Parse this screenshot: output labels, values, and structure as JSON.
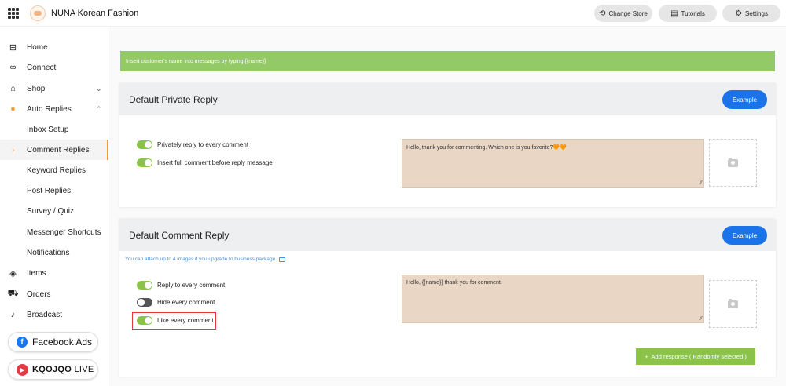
{
  "header": {
    "store_name": "NUNA Korean Fashion",
    "change_store": "Change Store",
    "tutorials": "Tutorials",
    "settings": "Settings"
  },
  "sidebar": {
    "items": [
      {
        "label": "Home",
        "icon": "home-icon"
      },
      {
        "label": "Connect",
        "icon": "link-icon"
      },
      {
        "label": "Shop",
        "icon": "shop-icon"
      },
      {
        "label": "Auto Replies",
        "icon": "chat-icon"
      },
      {
        "label": "Inbox Setup"
      },
      {
        "label": "Comment Replies"
      },
      {
        "label": "Keyword Replies"
      },
      {
        "label": "Post Replies"
      },
      {
        "label": "Survey / Quiz"
      },
      {
        "label": "Messenger Shortcuts"
      },
      {
        "label": "Notifications"
      },
      {
        "label": "Items",
        "icon": "box-icon"
      },
      {
        "label": "Orders",
        "icon": "cart-icon"
      },
      {
        "label": "Broadcast",
        "icon": "mic-icon"
      }
    ],
    "facebook_ads": "Facebook Ads",
    "kaojao_brand": "KQOJQO",
    "kaojao_live": "LIVE"
  },
  "main": {
    "tip": "Insert customer's name into messages by typing {{name}}",
    "private_reply": {
      "title": "Default Private Reply",
      "example": "Example",
      "toggles": [
        {
          "label": "Privately reply to every comment",
          "on": true
        },
        {
          "label": "Insert full comment before reply message",
          "on": true
        }
      ],
      "message": "Hello, thank you for commenting. Which one is you favorite?🧡🧡"
    },
    "comment_reply": {
      "title": "Default Comment Reply",
      "example": "Example",
      "upgrade_note": "You can attach up to 4 images if you upgrade to business package.",
      "toggles": [
        {
          "label": "Reply to every comment",
          "on": true
        },
        {
          "label": "Hide every comment",
          "on": false
        },
        {
          "label": "Like every comment",
          "on": true
        }
      ],
      "message": "Hello, {{name}} thank you for comment.",
      "add_response": "Add response ( Randomly selected )"
    }
  },
  "colors": {
    "accent_green": "#8bc34a",
    "tip_green": "#93c966",
    "example_blue": "#1a73e8",
    "active_orange": "#f39a3a",
    "message_bg": "#e9d6c4",
    "highlight_red": "#e53935"
  }
}
